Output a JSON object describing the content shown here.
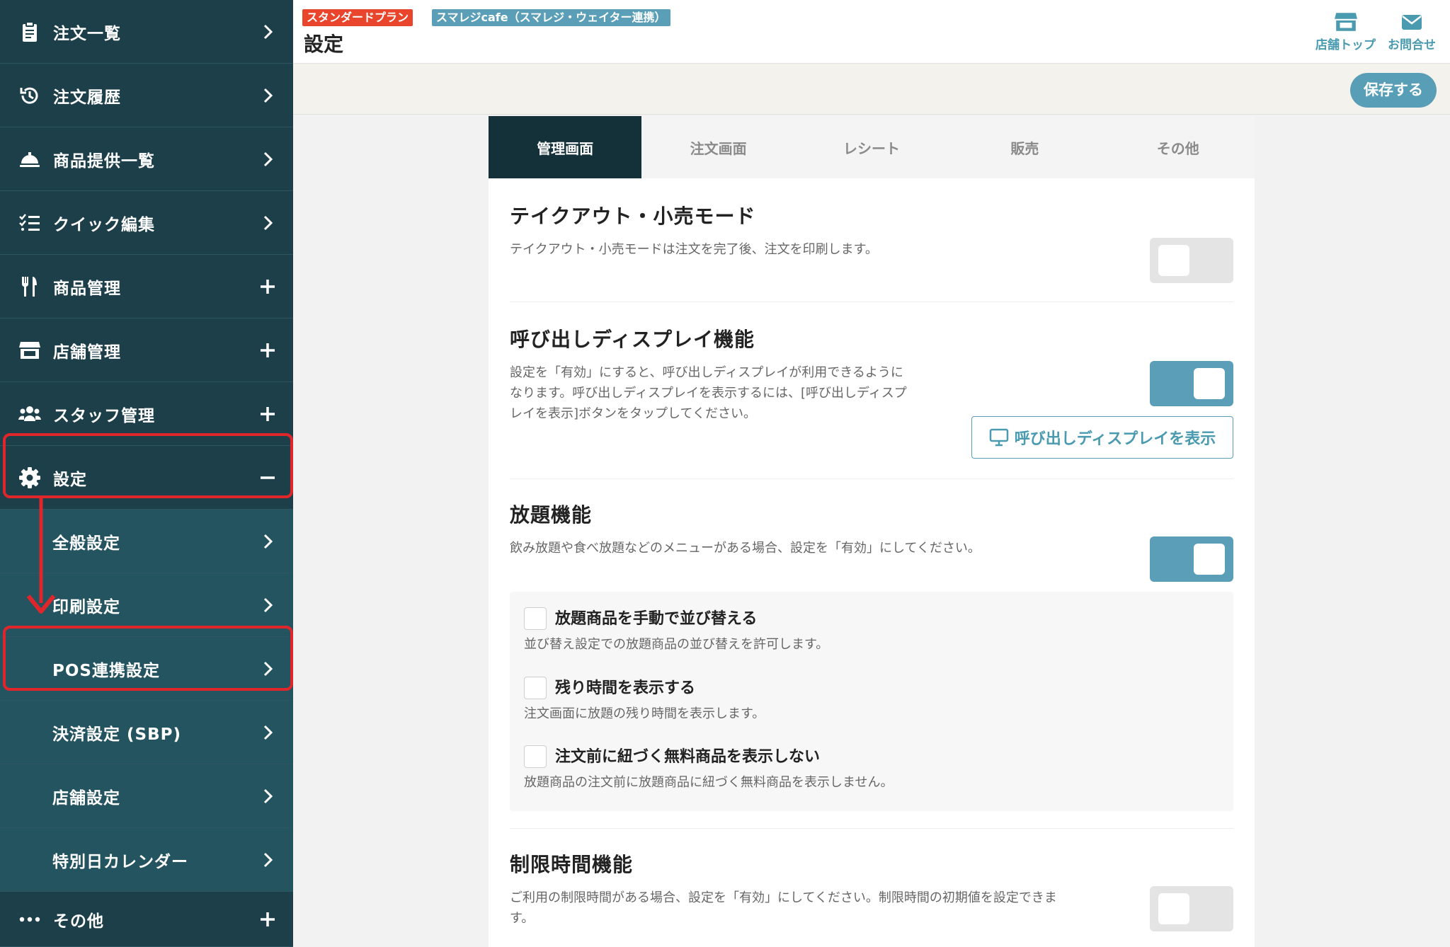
{
  "sidebar": {
    "items": [
      {
        "label": "注文一覧",
        "icon": "clipboard-icon",
        "tail": "chevron-right"
      },
      {
        "label": "注文履歴",
        "icon": "history-icon",
        "tail": "chevron-right"
      },
      {
        "label": "商品提供一覧",
        "icon": "cloche-icon",
        "tail": "chevron-right"
      },
      {
        "label": "クイック編集",
        "icon": "checklist-icon",
        "tail": "chevron-right"
      },
      {
        "label": "商品管理",
        "icon": "utensils-icon",
        "tail": "plus"
      },
      {
        "label": "店舗管理",
        "icon": "store-icon",
        "tail": "plus"
      },
      {
        "label": "スタッフ管理",
        "icon": "users-icon",
        "tail": "plus"
      },
      {
        "label": "設定",
        "icon": "gear-icon",
        "tail": "minus"
      }
    ],
    "sub_items": [
      {
        "label": "全般設定"
      },
      {
        "label": "印刷設定"
      },
      {
        "label": "POS連携設定"
      },
      {
        "label": "決済設定 (SBP)"
      },
      {
        "label": "店舗設定"
      },
      {
        "label": "特別日カレンダー"
      }
    ],
    "other": {
      "label": "その他",
      "icon": "ellipsis-icon"
    }
  },
  "header": {
    "plan_badge": "スタンダードプラン",
    "store_badge": "スマレジcafe（スマレジ・ウェイター連携）",
    "title": "設定",
    "store_top": "店舗トップ",
    "contact": "お問合せ"
  },
  "actions": {
    "save": "保存する"
  },
  "tabs": [
    "管理画面",
    "注文画面",
    "レシート",
    "販売",
    "その他"
  ],
  "sections": {
    "takeout": {
      "title": "テイクアウト・小売モード",
      "desc": "テイクアウト・小売モードは注文を完了後、注文を印刷します。",
      "enabled": false
    },
    "call_display": {
      "title": "呼び出しディスプレイ機能",
      "desc": [
        "設定を「有効」にすると、呼び出しディスプレイが利用できるように",
        "なります。呼び出しディスプレイを表示するには、[呼び出しディスプ",
        "レイを表示]ボタンをタップしてください。"
      ],
      "enabled": true,
      "button": "呼び出しディスプレイを表示"
    },
    "all_you_can": {
      "title": "放題機能",
      "desc": "飲み放題や食べ放題などのメニューがある場合、設定を「有効」にしてください。",
      "enabled": true,
      "options": [
        {
          "label": "放題商品を手動で並び替える",
          "desc": "並び替え設定での放題商品の並び替えを許可します。",
          "checked": false
        },
        {
          "label": "残り時間を表示する",
          "desc": "注文画面に放題の残り時間を表示します。",
          "checked": false
        },
        {
          "label": "注文前に紐づく無料商品を表示しない",
          "desc": "放題商品の注文前に放題商品に紐づく無料商品を表示しません。",
          "checked": false
        }
      ]
    },
    "time_limit": {
      "title": "制限時間機能",
      "desc": [
        "ご利用の制限時間がある場合、設定を「有効」にしてください。制限時間の初期値を設定できま",
        "す。"
      ],
      "enabled": false
    }
  },
  "colors": {
    "sidebar": "#1d3f49",
    "accent": "#589eb6",
    "highlight": "#e0262b",
    "plan_badge": "#e8452c",
    "store_badge": "#5a9fb7"
  }
}
